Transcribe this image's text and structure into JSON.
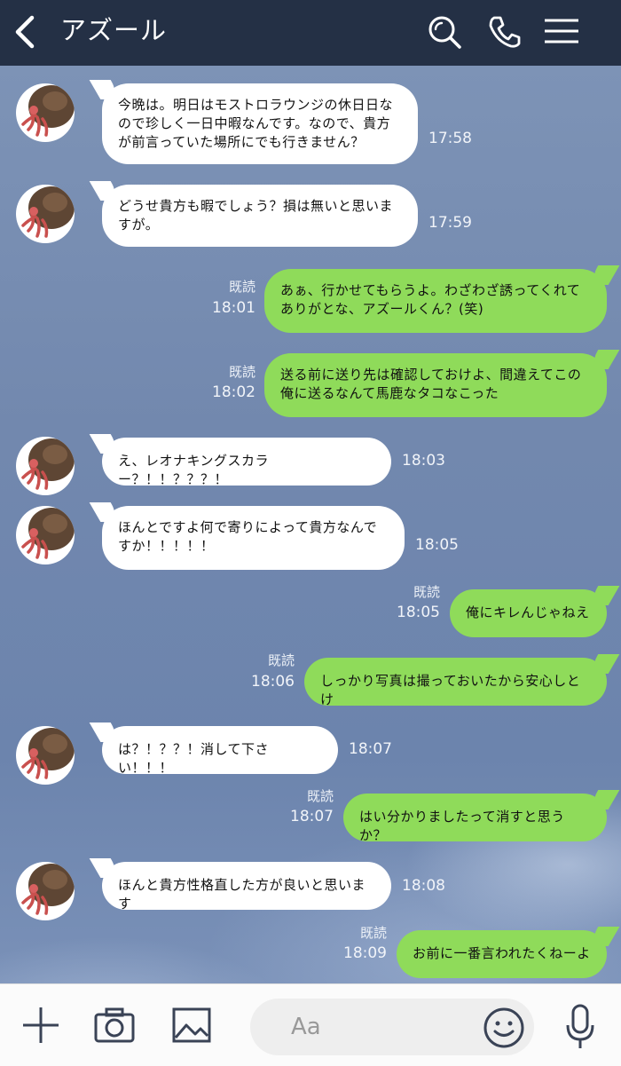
{
  "header": {
    "title": "アズール",
    "icons": [
      "back-icon",
      "search-icon",
      "phone-icon",
      "menu-icon"
    ]
  },
  "messages": [
    {
      "side": "in",
      "text": "今晩は。明日はモストロラウンジの休日日なので珍しく一日中暇なんです。なので、貴方が前言っていた場所にでも行きません？",
      "time": "17:58"
    },
    {
      "side": "in",
      "text": "どうせ貴方も暇でしょう？損は無いと思いますが。",
      "time": "17:59"
    },
    {
      "side": "out",
      "text": "あぁ、行かせてもらうよ。わざわざ誘ってくれてありがとな、アズールくん？(笑)",
      "time": "18:01",
      "read": "既読"
    },
    {
      "side": "out",
      "text": "送る前に送り先は確認しておけよ、間違えてこの俺に送るなんて馬鹿なタコなこった",
      "time": "18:02",
      "read": "既読"
    },
    {
      "side": "in",
      "text": "え、レオナキングスカラー？！！？？？！",
      "time": "18:03"
    },
    {
      "side": "in",
      "text": "ほんとですよ何で寄りによって貴方なんですか！！！！！",
      "time": "18:05"
    },
    {
      "side": "out",
      "text": "俺にキレんじゃねえ",
      "time": "18:05",
      "read": "既読"
    },
    {
      "side": "out",
      "text": "しっかり写真は撮っておいたから安心しとけ",
      "time": "18:06",
      "read": "既読"
    },
    {
      "side": "in",
      "text": "は？！？？！消して下さい！！！",
      "time": "18:07"
    },
    {
      "side": "out",
      "text": "はい分かりましたって消すと思うか？",
      "time": "18:07",
      "read": "既読"
    },
    {
      "side": "in",
      "text": "ほんと貴方性格直した方が良いと思います",
      "time": "18:08"
    },
    {
      "side": "out",
      "text": "お前に一番言われたくねーよ",
      "time": "18:09",
      "read": "既読"
    }
  ],
  "footer": {
    "input_placeholder": "Aa",
    "icons": [
      "plus-icon",
      "camera-icon",
      "image-icon",
      "emoji-icon",
      "mic-icon"
    ]
  },
  "colors": {
    "header_bg": "#243045",
    "outgoing_bubble": "#8fdb5a",
    "incoming_bubble": "#ffffff",
    "chat_bg": "#7288ae"
  }
}
